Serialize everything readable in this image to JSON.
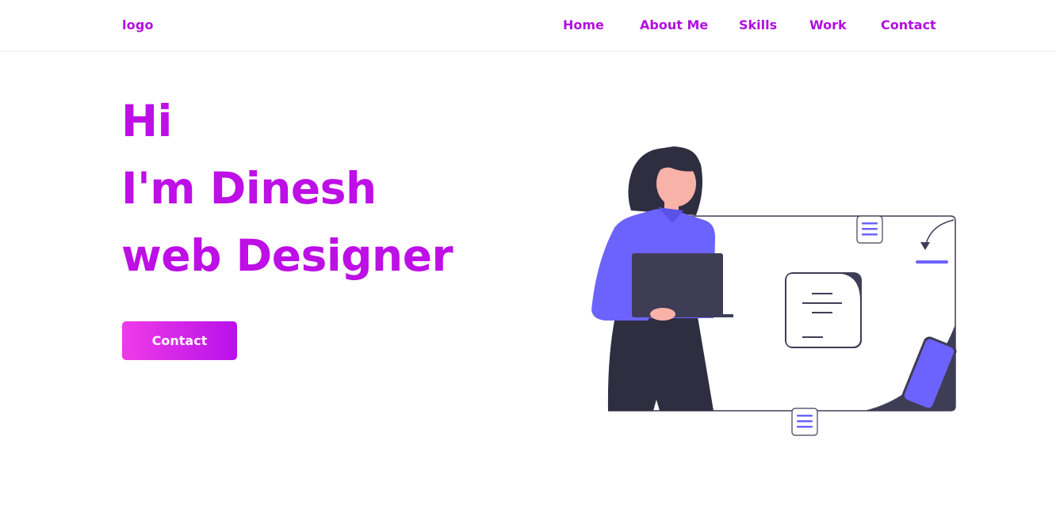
{
  "header": {
    "logo": "logo",
    "nav": [
      "Home",
      "About Me",
      "Skills",
      "Work",
      "Contact"
    ]
  },
  "hero": {
    "line1": "Hi",
    "line2": "I'm Dinesh",
    "line3": "web Designer",
    "button": "Contact"
  },
  "colors": {
    "accent": "#bd0fe6",
    "button_start": "#ef3be8",
    "button_end": "#b811ea",
    "illustration_purple": "#6c63ff",
    "illustration_dark": "#3f3d56"
  },
  "illustration": {
    "subject": "woman holding laptop beside web layout",
    "icons": [
      "menu-icon",
      "menu-icon",
      "arrow-icon",
      "smartphone-icon",
      "text-card"
    ]
  }
}
